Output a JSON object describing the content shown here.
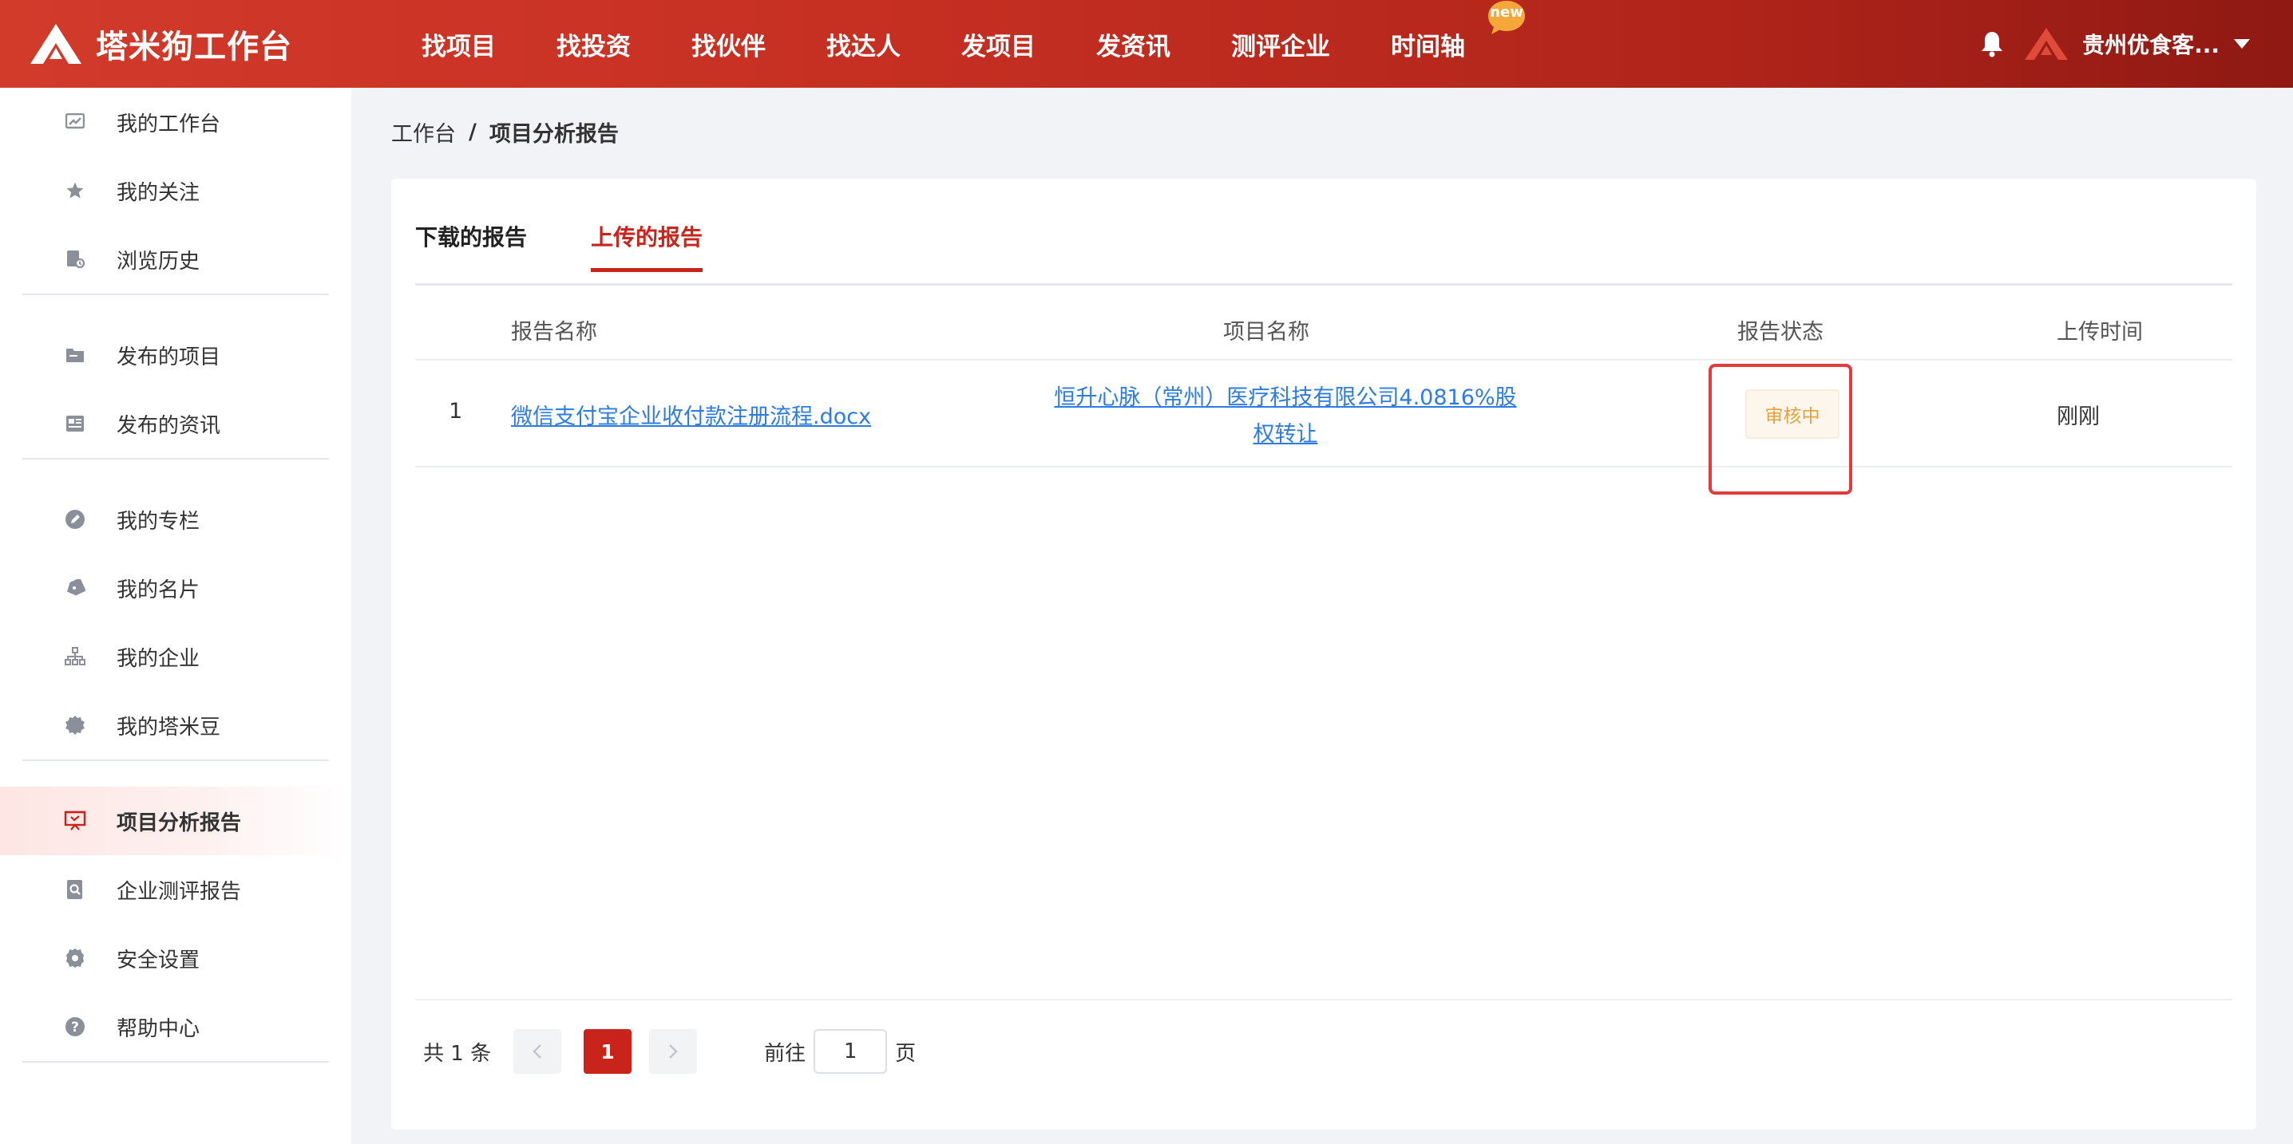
{
  "header": {
    "logo_text": "塔米狗工作台",
    "nav": [
      "找项目",
      "找投资",
      "找伙伴",
      "找达人",
      "发项目",
      "发资讯",
      "测评企业",
      "时间轴"
    ],
    "new_badge": "new",
    "user_name": "贵州优食客...",
    "brand_color": "#c8241b"
  },
  "sidebar": {
    "groups": [
      [
        {
          "label": "我的工作台",
          "icon": "chart-icon"
        },
        {
          "label": "我的关注",
          "icon": "star-icon"
        },
        {
          "label": "浏览历史",
          "icon": "history-icon"
        }
      ],
      [
        {
          "label": "发布的项目",
          "icon": "folder-icon"
        },
        {
          "label": "发布的资讯",
          "icon": "news-icon"
        }
      ],
      [
        {
          "label": "我的专栏",
          "icon": "pen-icon"
        },
        {
          "label": "我的名片",
          "icon": "tag-icon"
        },
        {
          "label": "我的企业",
          "icon": "org-icon"
        },
        {
          "label": "我的塔米豆",
          "icon": "coin-icon"
        }
      ],
      [
        {
          "label": "项目分析报告",
          "icon": "report-icon",
          "active": true
        },
        {
          "label": "企业测评报告",
          "icon": "search-doc-icon"
        },
        {
          "label": "安全设置",
          "icon": "gear-icon"
        },
        {
          "label": "帮助中心",
          "icon": "help-icon"
        }
      ]
    ]
  },
  "breadcrumb": {
    "root": "工作台",
    "separator": "/",
    "current": "项目分析报告"
  },
  "tabs": [
    "下载的报告",
    "上传的报告"
  ],
  "active_tab": 1,
  "table": {
    "columns": [
      "报告名称",
      "项目名称",
      "报告状态",
      "上传时间"
    ],
    "rows": [
      {
        "index": "1",
        "report_name": "微信支付宝企业收付款注册流程.docx",
        "project_name_line1": "恒升心脉（常州）医疗科技有限公司4.0816%股",
        "project_name_line2": "权转让",
        "status": "审核中",
        "upload_time": "刚刚"
      }
    ]
  },
  "pagination": {
    "total": "共 1 条",
    "current_page": "1",
    "goto_label": "前往",
    "goto_value": "1",
    "page_suffix": "页"
  }
}
